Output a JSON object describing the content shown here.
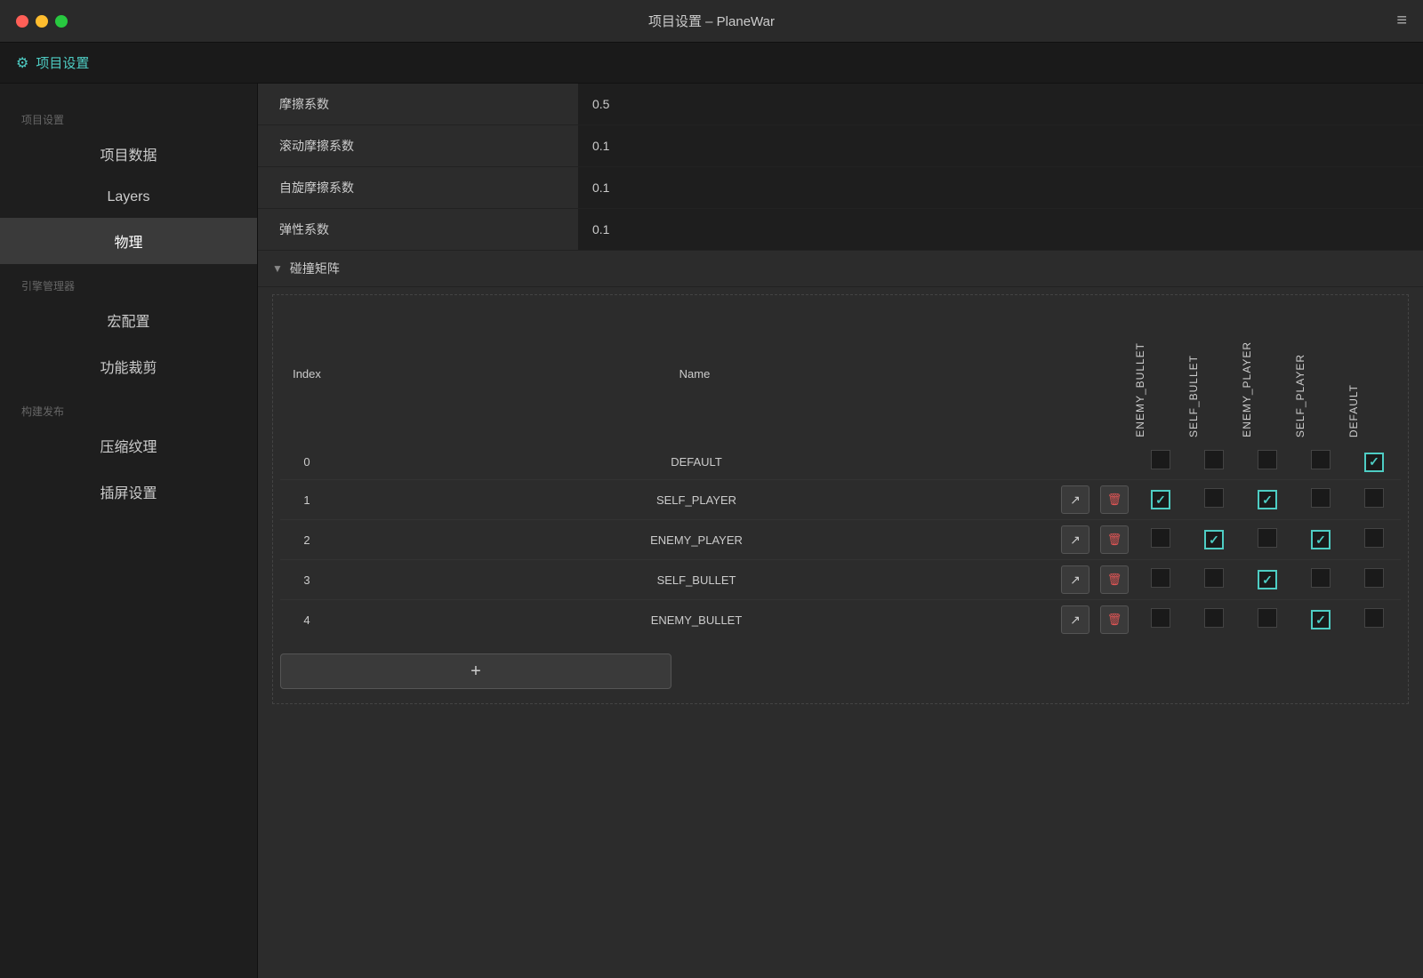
{
  "titlebar": {
    "title": "项目设置 – PlaneWar",
    "menu_icon": "≡"
  },
  "header": {
    "icon": "⚙",
    "title": "项目设置"
  },
  "sidebar": {
    "sections": [
      {
        "label": "项目设置",
        "items": [
          {
            "id": "project-data",
            "label": "项目数据",
            "active": false
          },
          {
            "id": "layers",
            "label": "Layers",
            "active": false
          },
          {
            "id": "physics",
            "label": "物理",
            "active": true
          }
        ]
      },
      {
        "label": "引擎管理器",
        "items": [
          {
            "id": "macro-config",
            "label": "宏配置",
            "active": false
          },
          {
            "id": "feature-clip",
            "label": "功能裁剪",
            "active": false
          }
        ]
      },
      {
        "label": "构建发布",
        "items": [
          {
            "id": "compress-texture",
            "label": "压缩纹理",
            "active": false
          },
          {
            "id": "splash-screen",
            "label": "插屏设置",
            "active": false
          }
        ]
      }
    ]
  },
  "content": {
    "properties": [
      {
        "label": "摩擦系数",
        "value": "0.5"
      },
      {
        "label": "滚动摩擦系数",
        "value": "0.1"
      },
      {
        "label": "自旋摩擦系数",
        "value": "0.1"
      },
      {
        "label": "弹性系数",
        "value": "0.1"
      }
    ],
    "collision_matrix": {
      "title": "碰撞矩阵",
      "columns": [
        "ENEMY_BULLET",
        "SELF_BULLET",
        "ENEMY_PLAYER",
        "SELF_PLAYER",
        "DEFAULT"
      ],
      "rows": [
        {
          "index": 0,
          "name": "DEFAULT",
          "has_edit": false,
          "has_delete": false,
          "checks": [
            false,
            false,
            false,
            false,
            true
          ]
        },
        {
          "index": 1,
          "name": "SELF_PLAYER",
          "has_edit": true,
          "has_delete": true,
          "checks": [
            true,
            false,
            true,
            false,
            false
          ]
        },
        {
          "index": 2,
          "name": "ENEMY_PLAYER",
          "has_edit": true,
          "has_delete": true,
          "checks": [
            false,
            true,
            false,
            true,
            false
          ]
        },
        {
          "index": 3,
          "name": "SELF_BULLET",
          "has_edit": true,
          "has_delete": true,
          "checks": [
            false,
            false,
            true,
            false,
            false
          ]
        },
        {
          "index": 4,
          "name": "ENEMY_BULLET",
          "has_edit": true,
          "has_delete": true,
          "checks": [
            false,
            false,
            false,
            true,
            false
          ]
        }
      ],
      "add_button": "+"
    }
  }
}
